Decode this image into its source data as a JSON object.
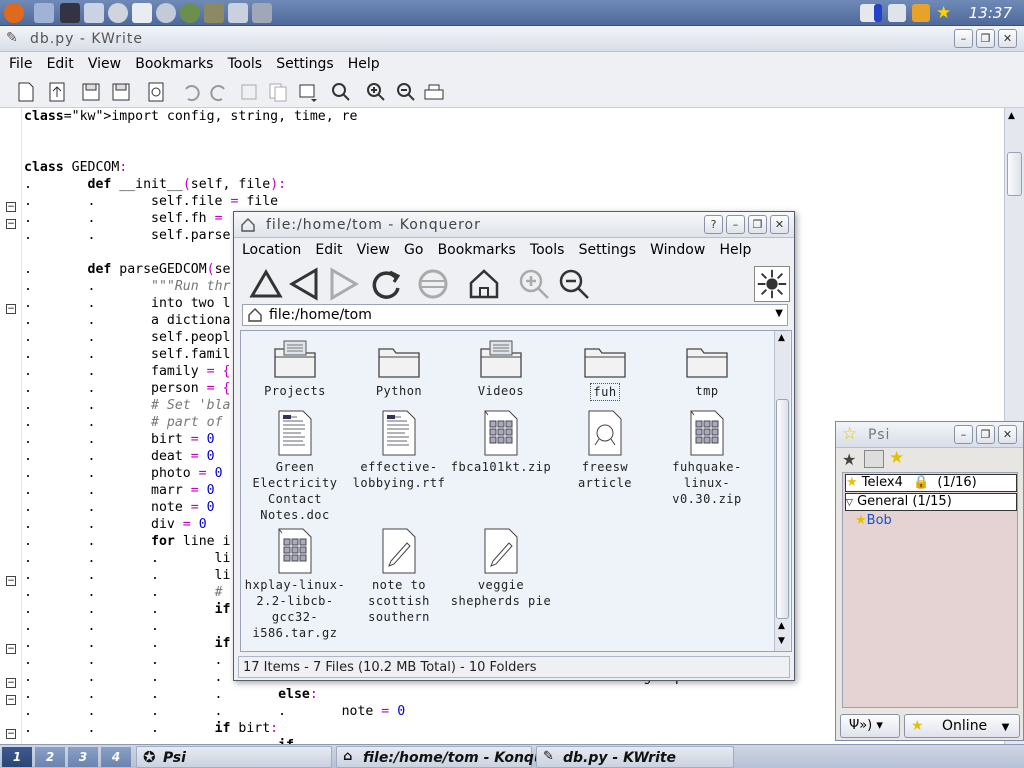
{
  "top_panel": {
    "clock": "13:37",
    "launchers": [
      "kmenu-icon",
      "show-desktop-icon",
      "terminal-icon",
      "home-icon",
      "settings-icon",
      "mail-icon",
      "psi-icon",
      "browser-icon",
      "package-icon",
      "games-icon",
      "tools-icon"
    ],
    "tray": [
      "volume-icon",
      "battery-icon",
      "clipboard-icon",
      "notes-icon",
      "psi-star-icon"
    ]
  },
  "kwrite": {
    "title": "db.py - KWrite",
    "menu": [
      "File",
      "Edit",
      "View",
      "Bookmarks",
      "Tools",
      "Settings",
      "Help"
    ],
    "toolbar": [
      "new-icon",
      "open-icon",
      "save-icon",
      "save-as-icon",
      "close-icon",
      "undo-icon",
      "redo-icon",
      "cut-icon",
      "copy-icon",
      "paste-icon",
      "find-icon",
      "zoom-in-icon",
      "zoom-out-icon",
      "print-icon"
    ],
    "code_lines": [
      "import config, string, time, re",
      "",
      "",
      "class GEDCOM:",
      ".       def __init__(self, file):",
      ".       .       self.file = file",
      ".       .       self.fh = ",
      ".       .       self.parse",
      "",
      ".       def parseGEDCOM(se",
      ".       .       \"\"\"Run thr",
      ".       .       into two l",
      ".       .       a dictiona",
      ".       .       self.peopl",
      ".       .       self.famil",
      ".       .       family = {",
      ".       .       person = {",
      ".       .       # Set 'bla",
      ".       .       # part of ",
      ".       .       birt = 0",
      ".       .       deat = 0",
      ".       .       photo = 0",
      ".       .       marr = 0",
      ".       .       note = 0",
      ".       .       div = 0",
      ".       .       for line i",
      ".       .       .       li",
      ".       .       .       li",
      ".       .       .       #",
      ".       .       .       if",
      ".       .       .       ",
      ".       .       .       if",
      ".       .       .       .",
      ".       .       .       .                                                     group",
      ".       .       .       .       else:",
      ".       .       .       .       .       note = 0",
      ".       .       .       if birt:",
      ".       .       .       .       if"
    ]
  },
  "konqueror": {
    "title": "file:/home/tom - Konqueror",
    "menu": [
      "Location",
      "Edit",
      "View",
      "Go",
      "Bookmarks",
      "Tools",
      "Settings",
      "Window",
      "Help"
    ],
    "toolbar": [
      "up-icon",
      "back-icon",
      "forward-icon",
      "reload-icon",
      "stop-icon",
      "home-icon",
      "zoom-in-icon",
      "zoom-out-icon",
      "activity-icon"
    ],
    "location": "file:/home/tom",
    "items": [
      {
        "name": "Projects",
        "kind": "folder-files"
      },
      {
        "name": "Python",
        "kind": "folder"
      },
      {
        "name": "Videos",
        "kind": "folder-files"
      },
      {
        "name": "fuh",
        "kind": "folder",
        "selected": true
      },
      {
        "name": "tmp",
        "kind": "folder"
      },
      {
        "name": "Green Electricity Contact Notes.doc",
        "kind": "document"
      },
      {
        "name": "effective-lobbying.rtf",
        "kind": "document"
      },
      {
        "name": "fbca101kt.zip",
        "kind": "archive"
      },
      {
        "name": "freesw article",
        "kind": "text"
      },
      {
        "name": "fuhquake-linux-v0.30.zip",
        "kind": "archive"
      },
      {
        "name": "hxplay-linux-2.2-libcb-gcc32-i586.tar.gz",
        "kind": "archive"
      },
      {
        "name": "note to scottish southern",
        "kind": "note"
      },
      {
        "name": "veggie shepherds pie",
        "kind": "note"
      }
    ],
    "status": "17 Items - 7 Files (10.2 MB Total) - 10 Folders"
  },
  "psi": {
    "title": "Psi",
    "account": "Telex4",
    "account_count": "(1/16)",
    "group": "General (1/15)",
    "contact": "Bob",
    "status": "Online"
  },
  "taskbar": {
    "desktops": [
      "1",
      "2",
      "3",
      "4"
    ],
    "tasks": [
      {
        "label": "Psi",
        "icon": "psi-star-icon"
      },
      {
        "label": "file:/home/tom - Konqueror",
        "icon": "home-icon"
      },
      {
        "label": "db.py - KWrite",
        "icon": "pencil-icon"
      }
    ]
  },
  "colors": {
    "panel": "#5b76a6",
    "selection": "#0a246a",
    "keyword_op": "#c000c0",
    "number": "#0000d0"
  }
}
